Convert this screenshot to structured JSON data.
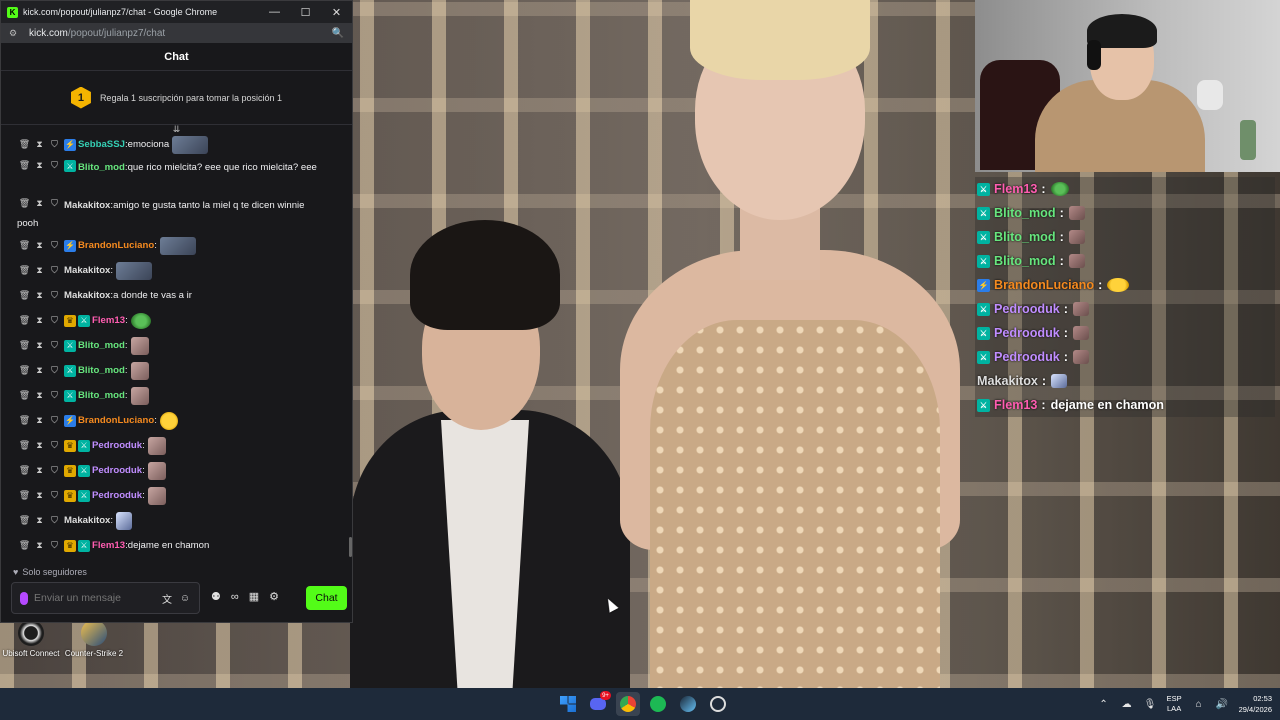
{
  "window": {
    "title": "kick.com/popout/julianpz7/chat - Google Chrome",
    "favicon": "K",
    "url_domain": "kick.com",
    "url_path": "/popout/julianpz7/chat",
    "controls": {
      "minimize": "—",
      "maximize": "☐",
      "close": "✕"
    }
  },
  "chat": {
    "header": "Chat",
    "promo_rank": "1",
    "promo_text": "Regala 1 suscripción para tomar la posición 1",
    "scroll_indicator": "⇊",
    "messages": [
      {
        "user": "SebbaSSJ",
        "text": "emociona",
        "color": "#35d0b5",
        "emote": "wide"
      },
      {
        "user": "Blito_mod",
        "text": "que rico mielcita? eee que rico mielcita? eee",
        "color": "#67e67e"
      },
      {
        "user": "Makakitox",
        "text": "amigo te gusta tanto la miel q te dicen winnie",
        "text2": "pooh",
        "color": "#dedede"
      },
      {
        "user": "BrandonLuciano",
        "text": "",
        "color": "#f58a1f",
        "emote": "wide"
      },
      {
        "user": "Makakitox",
        "text": "",
        "color": "#dedede",
        "emote": "wide"
      },
      {
        "user": "Makakitox",
        "text": "a donde te vas a ir",
        "color": "#dedede"
      },
      {
        "user": "Flem13",
        "text": "",
        "color": "#ff5db1",
        "emote": "frog"
      },
      {
        "user": "Blito_mod",
        "text": "",
        "color": "#67e67e",
        "emote": "person"
      },
      {
        "user": "Blito_mod",
        "text": "",
        "color": "#67e67e",
        "emote": "person"
      },
      {
        "user": "Blito_mod",
        "text": "",
        "color": "#67e67e",
        "emote": "person"
      },
      {
        "user": "BrandonLuciano",
        "text": "",
        "color": "#f58a1f",
        "emote": "face"
      },
      {
        "user": "Pedrooduk",
        "text": "",
        "color": "#c08dff",
        "emote": "person"
      },
      {
        "user": "Pedrooduk",
        "text": "",
        "color": "#c08dff",
        "emote": "person"
      },
      {
        "user": "Pedrooduk",
        "text": "",
        "color": "#c08dff",
        "emote": "person"
      },
      {
        "user": "Makakitox",
        "text": "",
        "color": "#dedede",
        "emote": "ghost"
      },
      {
        "user": "Flem13",
        "text": "dejame en chamon",
        "color": "#ff5db1"
      }
    ],
    "followers_only": "Solo seguidores",
    "input_placeholder": "Enviar un mensaje",
    "send_label": "Chat"
  },
  "desktop": {
    "icons": [
      "Ubisoft Connect",
      "Counter-Strike 2"
    ]
  },
  "overlay_chat": [
    {
      "user": "Flem13",
      "sep": ":",
      "text": "",
      "color": "#ff5db1",
      "emote": "frog"
    },
    {
      "user": "Blito_mod",
      "sep": ":",
      "text": "",
      "color": "#67e67e",
      "emote": "person"
    },
    {
      "user": "Blito_mod",
      "sep": ":",
      "text": "",
      "color": "#67e67e",
      "emote": "person"
    },
    {
      "user": "Blito_mod",
      "sep": ":",
      "text": "",
      "color": "#67e67e",
      "emote": "person"
    },
    {
      "user": "BrandonLuciano",
      "sep": ":",
      "text": "",
      "color": "#f58a1f",
      "emote": "face"
    },
    {
      "user": "Pedrooduk",
      "sep": ":",
      "text": "",
      "color": "#c08dff",
      "emote": "person"
    },
    {
      "user": "Pedrooduk",
      "sep": ":",
      "text": "",
      "color": "#c08dff",
      "emote": "person"
    },
    {
      "user": "Pedrooduk",
      "sep": ":",
      "text": "",
      "color": "#c08dff",
      "emote": "person"
    },
    {
      "user": "Makakitox",
      "sep": ":",
      "text": "",
      "color": "#dedede",
      "emote": "ghost"
    },
    {
      "user": "Flem13",
      "sep": ":",
      "text": "dejame en chamon",
      "color": "#ff5db1"
    }
  ],
  "taskbar": {
    "discord_badge": "9+",
    "lang_line1": "ESP",
    "lang_line2": "LAA",
    "time": "02:53",
    "date": "29/4/2026"
  },
  "colors": {
    "kick_green": "#53fc18",
    "sub_badge": "#2b7de9",
    "mod_badge": "#00b3a1"
  }
}
